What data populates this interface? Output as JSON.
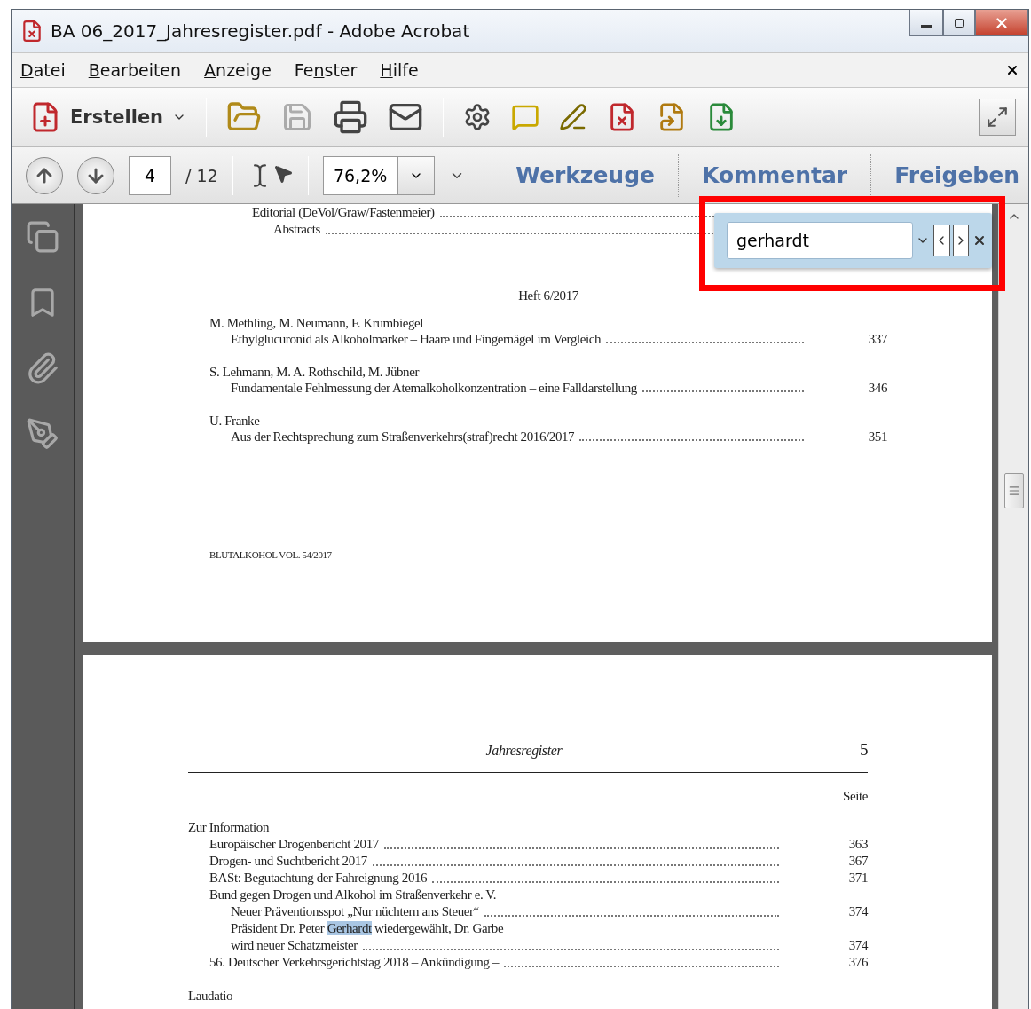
{
  "window": {
    "title": "BA 06_2017_Jahresregister.pdf - Adobe Acrobat"
  },
  "menu": [
    {
      "key": "D",
      "after": "atei"
    },
    {
      "key": "B",
      "after": "earbeiten"
    },
    {
      "key": "A",
      "after": "nzeige"
    },
    {
      "before": "Fe",
      "key": "n",
      "after": "ster"
    },
    {
      "key": "H",
      "after": "ilfe"
    }
  ],
  "toolbar": {
    "create_label": "Erstellen"
  },
  "navigation": {
    "page": "4",
    "page_count": "/ 12",
    "zoom": "76,2%",
    "panels": [
      "Werkzeuge",
      "Kommentar",
      "Freigeben"
    ]
  },
  "find_bar": {
    "value": "gerhardt"
  },
  "pages": [
    {
      "kind": "issue",
      "entries": [
        {
          "text": "Editorial (DeVol/Graw/Fastenmeier)",
          "children": [
            {
              "text": "Abstracts"
            }
          ]
        }
      ],
      "section": "Heft 6/2017",
      "articles": [
        {
          "authors": "M. Methling, M. Neumann, F. Krumbiegel",
          "title": "Ethylglucuronid als Alkoholmarker – Haare und Fingernägel im Vergleich",
          "page": "337"
        },
        {
          "authors": "S. Lehmann, M. A. Rothschild, M. Jübner",
          "title": "Fundamentale Fehlmessung der Atemalkoholkonzentration – eine Falldarstellung",
          "page": "346"
        },
        {
          "authors": "U. Franke",
          "title": "Aus der Rechtsprechung zum Straßenverkehrs(straf)recht 2016/2017",
          "page": "351"
        }
      ],
      "footer": "BLUTALKOHOL VOL. 54/2017"
    },
    {
      "kind": "register",
      "running_title": "Jahresregister",
      "number": "5",
      "column_heading": "Seite",
      "sections": [
        {
          "heading": "Zur Information",
          "items": [
            {
              "segments": [
                {
                  "text": "Europäischer Drogenbericht 2017",
                  "highlighted": false
                }
              ],
              "page": "363"
            },
            {
              "segments": [
                {
                  "text": "Drogen- und Suchtbericht 2017",
                  "highlighted": false
                }
              ],
              "page": "367"
            },
            {
              "segments": [
                {
                  "text": "BASt: Begutachtung der Fahreignung 2016",
                  "highlighted": false
                }
              ],
              "page": "371"
            },
            {
              "segments": [
                {
                  "text": "Bund gegen Drogen und Alkohol im Straßenverkehr e. V.",
                  "highlighted": false
                }
              ],
              "children": [
                {
                  "segments": [
                    {
                      "text": "Neuer Präventionsspot „Nur nüchtern ans Steuer“",
                      "highlighted": false
                    }
                  ],
                  "page": "374"
                },
                {
                  "segments": [
                    {
                      "text": "Präsident Dr. Peter ",
                      "highlighted": false
                    },
                    {
                      "text": "Gerhardt",
                      "highlighted": true
                    },
                    {
                      "text": " wiedergewählt, Dr. Garbe",
                      "highlighted": false
                    }
                  ],
                  "continuation": "wird neuer Schatzmeister",
                  "page": "374"
                }
              ]
            },
            {
              "segments": [
                {
                  "text": "56. Deutscher Verkehrsgerichtstag 2018 – Ankündigung –",
                  "highlighted": false
                }
              ],
              "page": "376"
            }
          ]
        },
        {
          "heading": "Laudatio"
        }
      ]
    }
  ]
}
